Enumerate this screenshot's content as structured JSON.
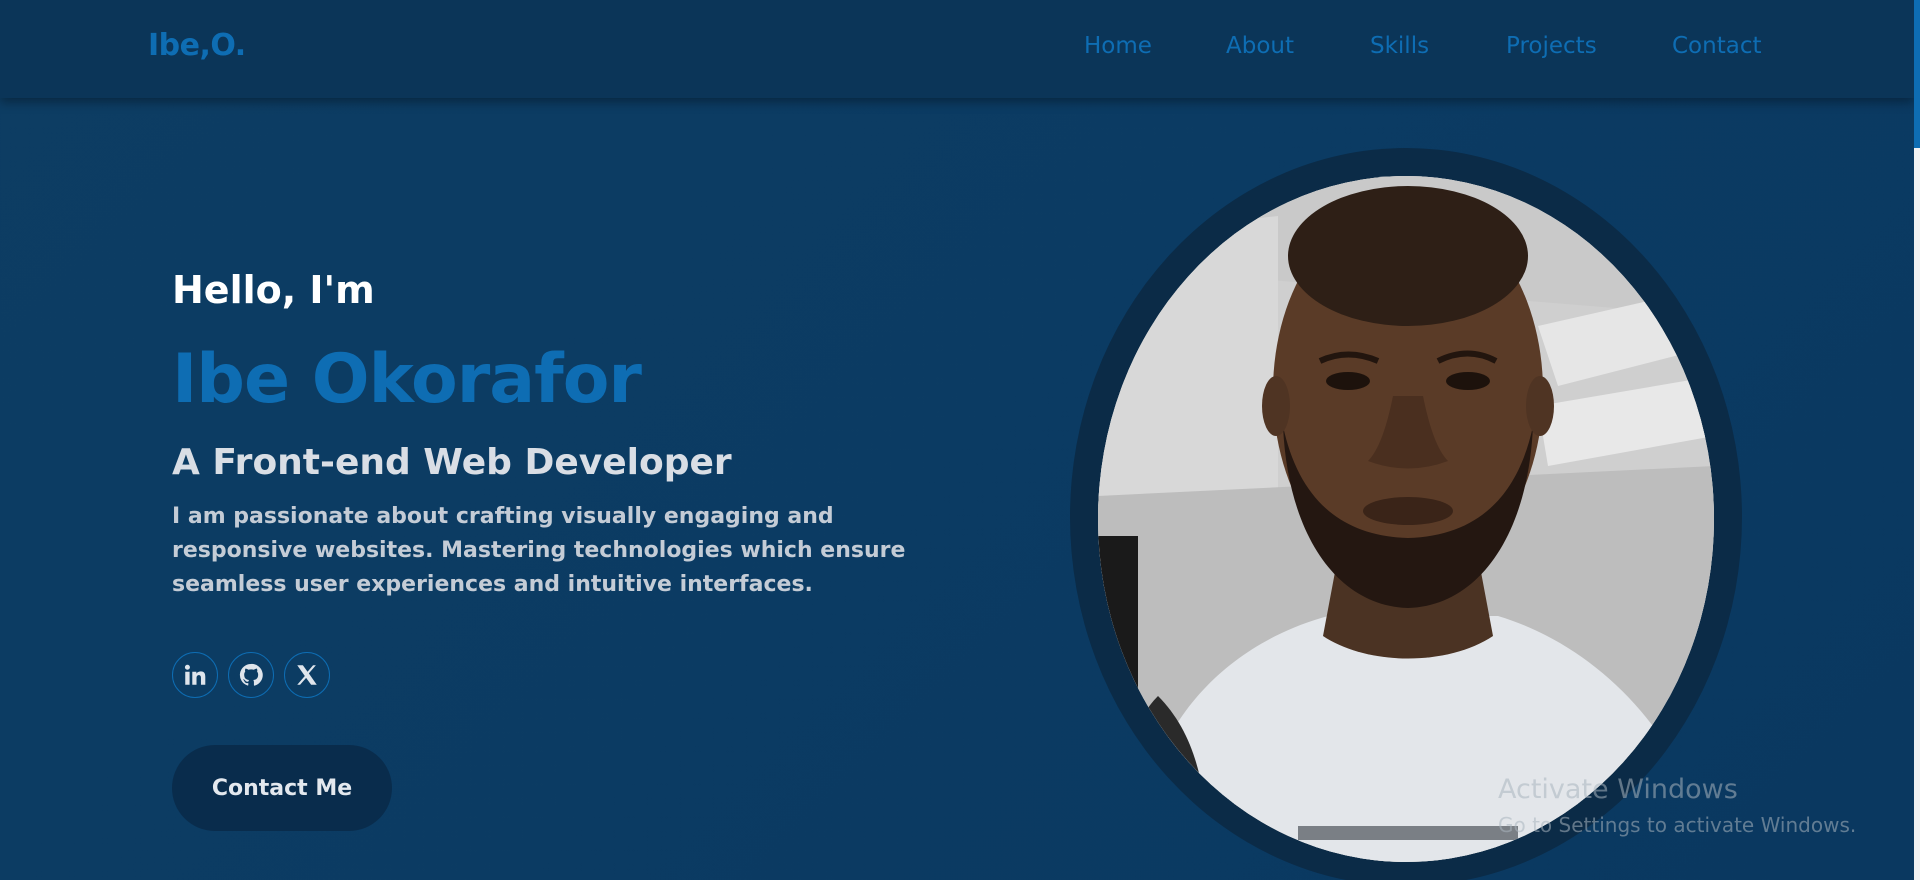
{
  "nav": {
    "logo": "Ibe,O.",
    "links": [
      "Home",
      "About",
      "Skills",
      "Projects",
      "Contact"
    ]
  },
  "hero": {
    "greeting": "Hello, I'm",
    "name": "Ibe Okorafor",
    "role": "A Front-end Web Developer",
    "description": "I am passionate about crafting visually engaging and responsive websites. Mastering technologies which ensure seamless user experiences and intuitive interfaces.",
    "socials": [
      {
        "icon": "linkedin-icon"
      },
      {
        "icon": "github-icon"
      },
      {
        "icon": "x-icon"
      }
    ],
    "cta": "Contact Me"
  },
  "watermark": {
    "title": "Activate Windows",
    "subtitle": "Go to Settings to activate Windows."
  },
  "colors": {
    "background": "#0b3b63",
    "navbar": "#0b3558",
    "accent": "#0e6db3",
    "button": "#092c4c",
    "photo_ring": "#0b2b47"
  }
}
